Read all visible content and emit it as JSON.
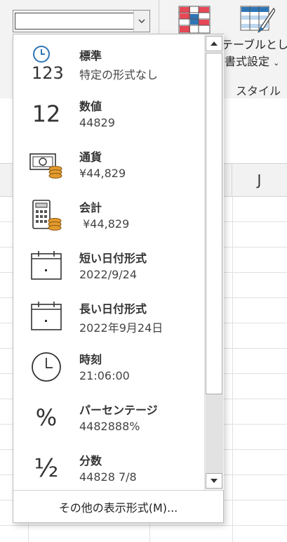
{
  "ribbon": {
    "table_label_line1": "テーブルとして",
    "table_label_line2": "書式設定",
    "styles_group": "スタイル"
  },
  "grid": {
    "column_label": "J"
  },
  "format_combo": {
    "value": ""
  },
  "dropdown": {
    "items": [
      {
        "title": "標準",
        "preview": "特定の形式なし",
        "icon": "clock-123-icon",
        "glyph": "123"
      },
      {
        "title": "数値",
        "preview": "44829",
        "icon": "number-12-icon",
        "glyph": "12"
      },
      {
        "title": "通貨",
        "preview": "¥44,829",
        "icon": "currency-bill-icon"
      },
      {
        "title": "会計",
        "preview": " ¥44,829",
        "icon": "calculator-coins-icon"
      },
      {
        "title": "短い日付形式",
        "preview": "2022/9/24",
        "icon": "calendar-icon"
      },
      {
        "title": "長い日付形式",
        "preview": "2022年9月24日",
        "icon": "calendar-icon"
      },
      {
        "title": "時刻",
        "preview": "21:06:00",
        "icon": "clock-icon"
      },
      {
        "title": "パーセンテージ",
        "preview": "4482888%",
        "icon": "percent-icon",
        "glyph": "%"
      },
      {
        "title": "分数",
        "preview": "44828 7/8",
        "icon": "fraction-icon",
        "glyph": "½"
      }
    ],
    "more_formats": "その他の表示形式(M)..."
  },
  "colors": {
    "orange": "#e39a2d",
    "red": "#e74856",
    "blue": "#2e75b6"
  }
}
